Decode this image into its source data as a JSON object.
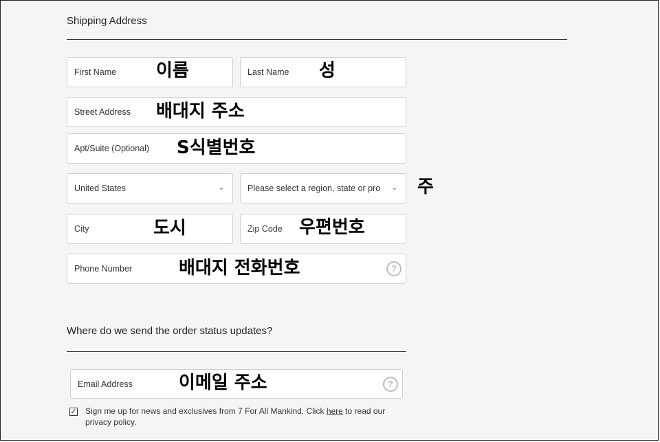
{
  "shipping": {
    "heading": "Shipping Address",
    "fields": {
      "first_name": {
        "label": "First Name",
        "annotation": "이름"
      },
      "last_name": {
        "label": "Last Name",
        "annotation": "성"
      },
      "street": {
        "label": "Street Address",
        "annotation": "배대지 주소"
      },
      "apt": {
        "label": "Apt/Suite (Optional)",
        "annotation": "S식별번호"
      },
      "country": {
        "value": "United States"
      },
      "region": {
        "value": "Please select a region, state or pro",
        "annotation": "주"
      },
      "city": {
        "label": "City",
        "annotation": "도시"
      },
      "zip": {
        "label": "Zip Code",
        "annotation": "우편번호"
      },
      "phone": {
        "label": "Phone Number",
        "annotation": "배대지 전화번호"
      }
    }
  },
  "updates": {
    "heading": "Where do we send the order status updates?",
    "email": {
      "label": "Email Address",
      "annotation": "이메일 주소"
    }
  },
  "consent": {
    "text_before": "Sign me up for news and exclusives from 7 For All Mankind. Click ",
    "link": "here",
    "text_after": " to read our privacy policy.",
    "checked": true
  },
  "icons": {
    "chevron": "chevron-down-icon",
    "help": "question-circle-icon",
    "check": "check-icon"
  }
}
